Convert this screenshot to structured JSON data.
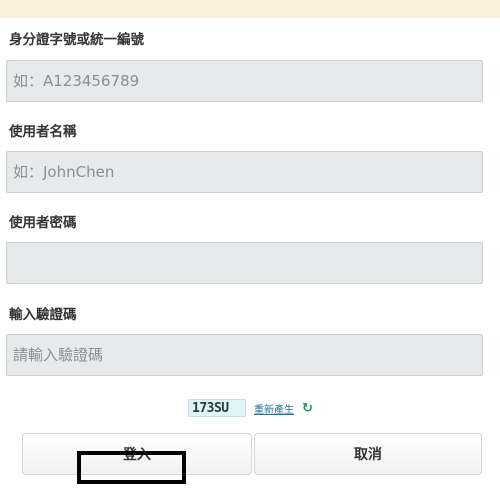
{
  "form": {
    "id_label": "身分證字號或統一編號",
    "id_placeholder": "如：A123456789",
    "username_label": "使用者名稱",
    "username_placeholder": "如：JohnChen",
    "password_label": "使用者密碼",
    "password_placeholder": "",
    "captcha_label": "輸入驗證碼",
    "captcha_placeholder": "請輸入驗證碼"
  },
  "captcha": {
    "code": "173SU",
    "regenerate_label": "重新產生",
    "refresh_icon": "refresh-icon"
  },
  "actions": {
    "login_label": "登入",
    "cancel_label": "取消"
  },
  "colors": {
    "background_top": "#fbf2de",
    "background_bottom": "#efc968",
    "field_bg": "#e6eaea",
    "link": "#2a6f8a",
    "highlight": "#000000"
  }
}
